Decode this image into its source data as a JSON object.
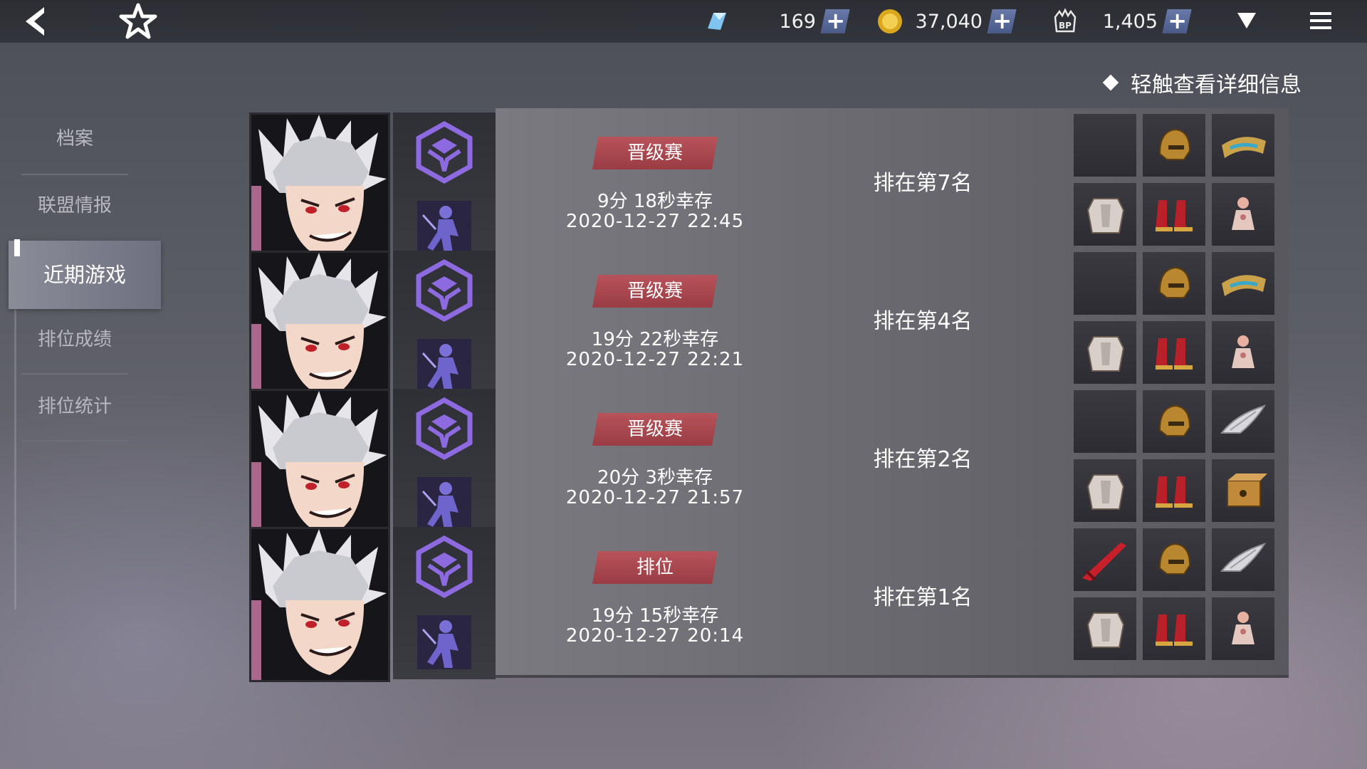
{
  "topbar": {
    "resources": [
      {
        "icon": "crystal-icon",
        "value": "169"
      },
      {
        "icon": "gold-coin-icon",
        "value": "37,040"
      },
      {
        "icon": "bp-icon",
        "value": "1,405"
      }
    ],
    "plus_label": "+"
  },
  "sidebar": {
    "items": [
      {
        "label": "档案"
      },
      {
        "label": "联盟情报"
      },
      {
        "label": "近期游戏"
      },
      {
        "label": "排位成绩"
      },
      {
        "label": "排位统计"
      }
    ],
    "active_index": 2
  },
  "hint": "轻触查看详细信息",
  "matches": [
    {
      "mode": "晋级赛",
      "survival": "9分 18秒幸存",
      "datetime": "2020-12-27 22:45",
      "rank": "排在第7名",
      "items": [
        "empty",
        "helmet-icon",
        "bracer-icon",
        "armor-icon",
        "boots-icon",
        "trinket-icon"
      ]
    },
    {
      "mode": "晋级赛",
      "survival": "19分 22秒幸存",
      "datetime": "2020-12-27 22:21",
      "rank": "排在第4名",
      "items": [
        "empty",
        "helmet-icon",
        "bracer-icon",
        "armor-icon",
        "boots-icon",
        "trinket-icon"
      ]
    },
    {
      "mode": "晋级赛",
      "survival": "20分 3秒幸存",
      "datetime": "2020-12-27 21:57",
      "rank": "排在第2名",
      "items": [
        "empty",
        "helmet-icon",
        "wing-icon",
        "armor-icon",
        "boots-icon",
        "box-icon"
      ]
    },
    {
      "mode": "排位",
      "survival": "19分 15秒幸存",
      "datetime": "2020-12-27 20:14",
      "rank": "排在第1名",
      "items": [
        "sword-icon",
        "helmet-icon",
        "wing-icon",
        "armor-icon",
        "boots-icon",
        "trinket-icon"
      ]
    }
  ]
}
